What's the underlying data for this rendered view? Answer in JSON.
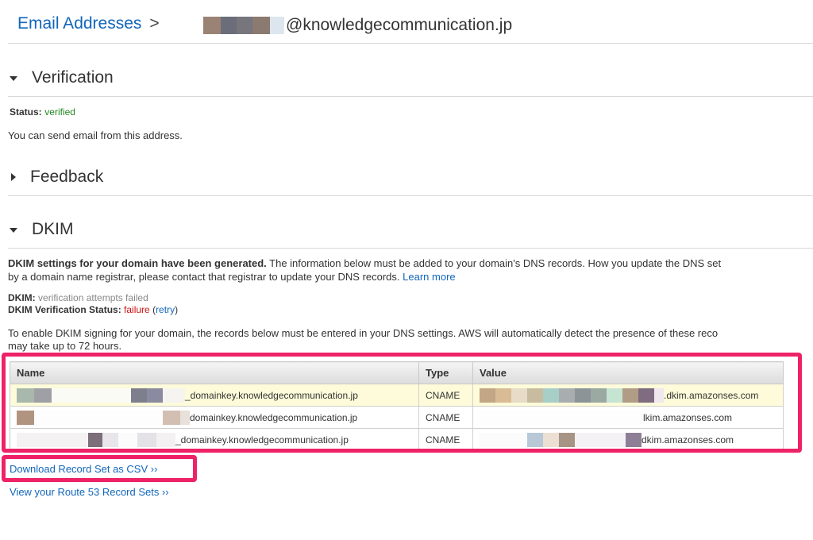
{
  "header": {
    "breadcrumb_link": "Email Addresses",
    "separator": ">",
    "email_suffix": "@knowledgecommunication.jp"
  },
  "verification": {
    "title": "Verification",
    "status_label": "Status:",
    "status_value": "verified",
    "message": "You can send email from this address."
  },
  "feedback": {
    "title": "Feedback"
  },
  "dkim": {
    "title": "DKIM",
    "intro_bold": "DKIM settings for your domain have been generated.",
    "intro_rest": " The information below must be added to your domain's DNS records. How you update the DNS set",
    "intro_line2": "by a domain name registrar, please contact that registrar to update your DNS records.",
    "learn_more": "Learn more",
    "dkim_label": "DKIM:",
    "dkim_value": "verification attempts failed",
    "status_label": "DKIM Verification Status:",
    "status_value": "failure",
    "retry_open": "(",
    "retry": "retry",
    "retry_close": ")",
    "enable_line1": "To enable DKIM signing for your domain, the records below must be entered in your DNS settings. AWS will automatically detect the presence of these reco",
    "enable_line2": "may take up to 72 hours.",
    "table": {
      "headers": [
        "Name",
        "Type",
        "Value"
      ],
      "rows": [
        {
          "name_suffix": "_domainkey.knowledgecommunication.jp",
          "type": "CNAME",
          "value_suffix": ".dkim.amazonses.com"
        },
        {
          "name_suffix": "domainkey.knowledgecommunication.jp",
          "type": "CNAME",
          "value_suffix": "lkim.amazonses.com"
        },
        {
          "name_suffix": "_domainkey.knowledgecommunication.jp",
          "type": "CNAME",
          "value_suffix": "dkim.amazonses.com"
        }
      ]
    },
    "download_csv": "Download Record Set as CSV ››",
    "route53": "View your Route 53 Record Sets ››"
  },
  "colors": {
    "link": "#1166bb",
    "verified": "#228822",
    "failure": "#cc1111",
    "highlight_box": "#ee2266",
    "row_highlight": "#fdfbd9"
  }
}
